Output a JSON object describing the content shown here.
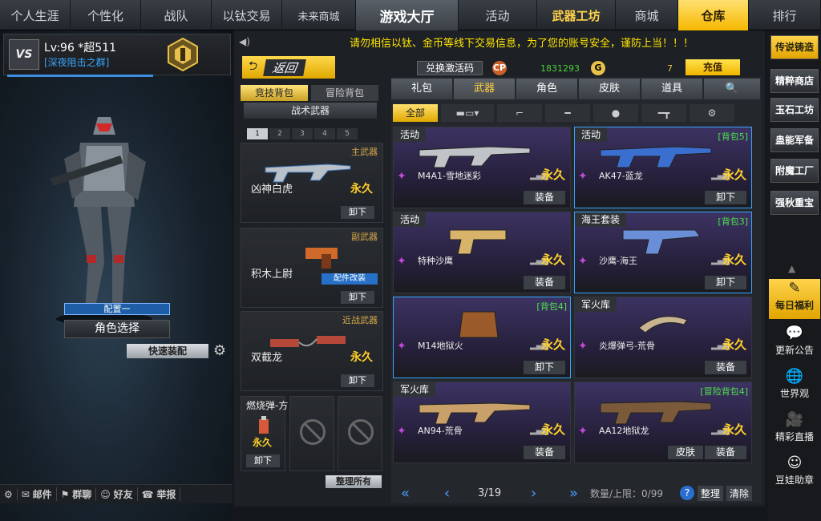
{
  "topnav": {
    "tabs": [
      "个人生涯",
      "个性化",
      "战队",
      "以钛交易",
      "未来商城",
      "游戏大厅",
      "活动",
      "武器工坊",
      "商城",
      "仓库",
      "排行"
    ]
  },
  "player": {
    "vip_badge": "VS",
    "level": "Lv:96 *超511",
    "clan": "[深夜阻击之群]",
    "config_label": "配置一",
    "role_select": "角色选择",
    "quick_equip": "快速装配"
  },
  "bottombar": {
    "items": [
      "邮件",
      "群聊",
      "好友",
      "举报"
    ]
  },
  "notice": "请勿相信以钛、金币等线下交易信息，为了您的账号安全，谨防上当！！！",
  "header": {
    "back": "返回",
    "cdkey": "兑换激活码",
    "cp_value": "1831293",
    "gold_value": "7",
    "recharge": "充值"
  },
  "left_panel": {
    "packs": [
      "竞技背包",
      "冒险背包"
    ],
    "tactical": "战术武器",
    "pages": [
      "1",
      "2",
      "3",
      "4",
      "5"
    ],
    "slots": [
      {
        "category": "主武器",
        "name": "凶神白虎",
        "perm": "永久",
        "btn": "卸下"
      },
      {
        "category": "副武器",
        "name": "积木上尉",
        "perm": "",
        "btn": "卸下",
        "mod": "配件改装"
      },
      {
        "category": "近战武器",
        "name": "双截龙",
        "perm": "永久",
        "btn": "卸下"
      }
    ],
    "grenade": {
      "name": "燃烧弹-方",
      "perm": "永久",
      "btn": "卸下"
    },
    "tidy": "整理所有"
  },
  "inventory": {
    "tabs": [
      "礼包",
      "武器",
      "角色",
      "皮肤",
      "道具"
    ],
    "subtabs": [
      "全部"
    ],
    "cards": [
      {
        "tag": "活动",
        "bag": "",
        "name": "M4A1-雪地迷彩",
        "perm": "永久",
        "btn": "装备",
        "btn2": ""
      },
      {
        "tag": "活动",
        "bag": "[背包5]",
        "name": "AK47-蓝龙",
        "perm": "永久",
        "btn": "卸下",
        "btn2": ""
      },
      {
        "tag": "活动",
        "bag": "",
        "name": "特种沙鹰",
        "perm": "永久",
        "btn": "装备",
        "btn2": ""
      },
      {
        "tag": "海王套装",
        "bag": "[背包3]",
        "name": "沙鹰-海王",
        "perm": "永久",
        "btn": "卸下",
        "btn2": ""
      },
      {
        "tag": "",
        "bag": "[背包4]",
        "name": "M14地狱火",
        "perm": "永久",
        "btn": "卸下",
        "btn2": ""
      },
      {
        "tag": "军火库",
        "bag": "",
        "name": "炎爆弹弓-荒骨",
        "perm": "永久",
        "btn": "装备",
        "btn2": ""
      },
      {
        "tag": "军火库",
        "bag": "",
        "name": "AN94-荒骨",
        "perm": "永久",
        "btn": "装备",
        "btn2": ""
      },
      {
        "tag": "",
        "bag": "[冒险背包4]",
        "name": "AA12地狱龙",
        "perm": "永久",
        "btn": "装备",
        "btn2": "皮肤"
      }
    ],
    "page": "3/19",
    "capacity": "数量/上限：0/99",
    "sort": "整理",
    "clear": "清除"
  },
  "right": {
    "buttons": [
      "传说铸造",
      "精粹商店",
      "玉石工坊",
      "蛊能军备",
      "附魔工厂",
      "强秋重宝"
    ],
    "items": [
      "每日福利",
      "更新公告",
      "世界观",
      "精彩直播",
      "豆娃助章"
    ]
  }
}
